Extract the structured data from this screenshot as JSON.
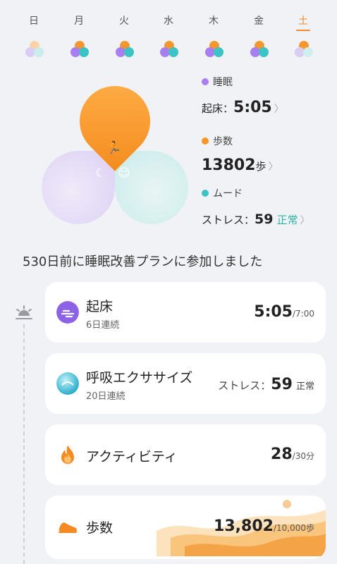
{
  "week": {
    "days": [
      {
        "label": "日"
      },
      {
        "label": "月"
      },
      {
        "label": "火"
      },
      {
        "label": "水"
      },
      {
        "label": "木"
      },
      {
        "label": "金"
      },
      {
        "label": "土",
        "active": true
      }
    ]
  },
  "summary": {
    "sleep": {
      "label": "睡眠",
      "color": "#a97ef0"
    },
    "wake": {
      "label": "起床：",
      "value": "5:05"
    },
    "steps": {
      "label": "歩数",
      "color": "#f6962e",
      "value": "13802",
      "unit": "歩"
    },
    "mood": {
      "label": "ムード",
      "color": "#3cc3c5"
    },
    "stress": {
      "label": "ストレス：",
      "value": "59",
      "status": "正常"
    }
  },
  "plan": {
    "title": "530日前に睡眠改善プランに参加しました"
  },
  "cards": {
    "wake": {
      "title": "起床",
      "sub": "6日連続",
      "value": "5:05",
      "target": "/7:00"
    },
    "breathing": {
      "title": "呼吸エクササイズ",
      "sub": "20日連続",
      "label": "ストレス：",
      "value": "59",
      "status": "正常"
    },
    "activity": {
      "title": "アクティビティ",
      "value": "28",
      "target": "/30分"
    },
    "steps": {
      "title": "歩数",
      "value": "13,802",
      "target": "/10,000歩"
    }
  }
}
